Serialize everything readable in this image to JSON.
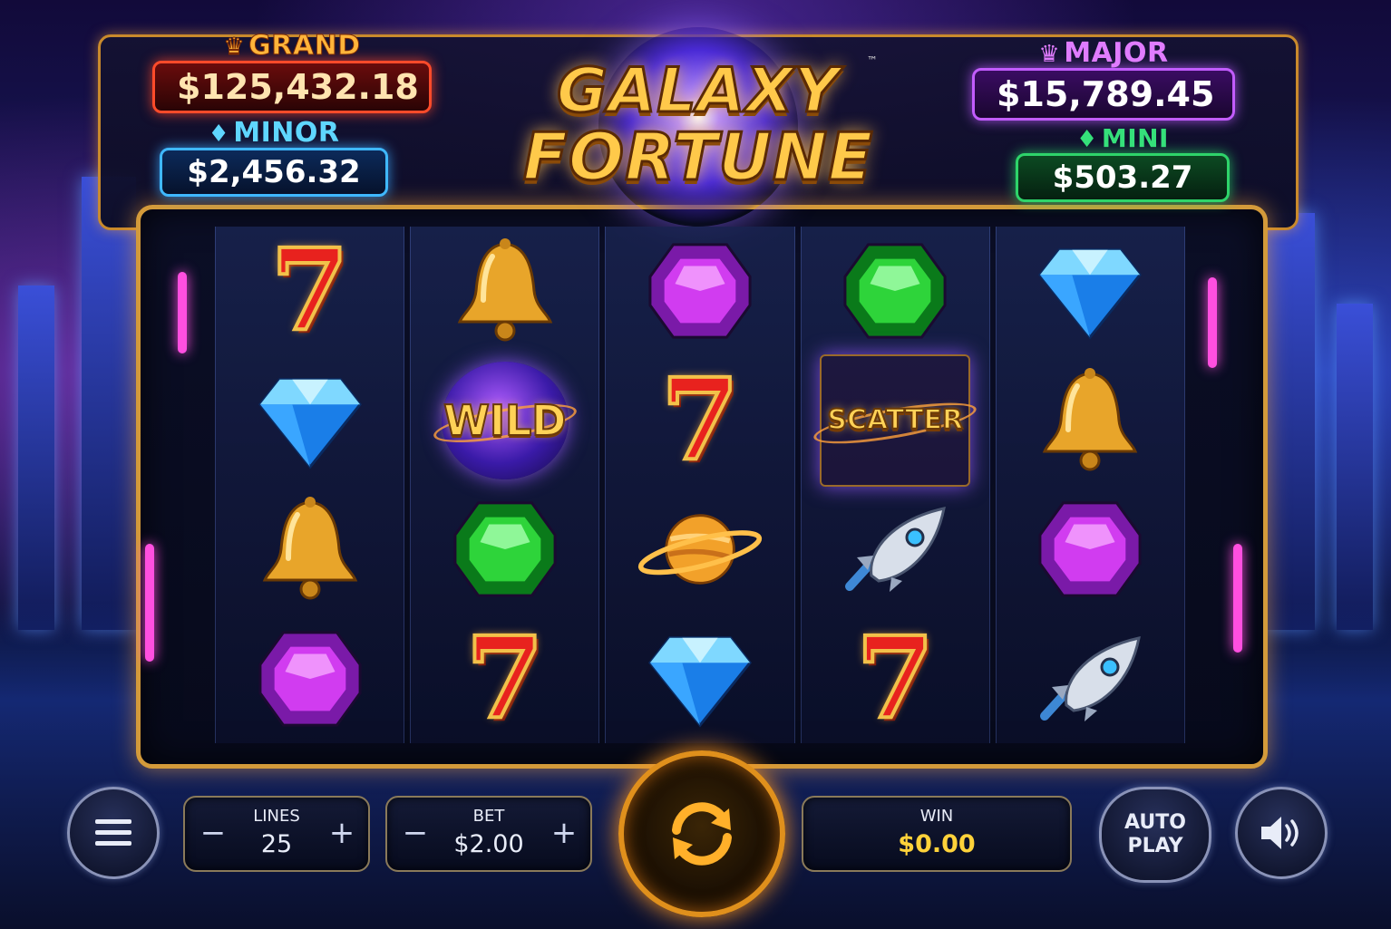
{
  "game": {
    "logo_line1": "GALAXY",
    "logo_line2": "FORTUNE",
    "trademark": "™"
  },
  "jackpots": {
    "grand": {
      "label": "GRAND",
      "amount": "$125,432.18",
      "color": "#ff4b2a"
    },
    "minor": {
      "label": "MINOR",
      "amount": "$2,456.32",
      "color": "#3fb8ff"
    },
    "major": {
      "label": "MAJOR",
      "amount": "$15,789.45",
      "color": "#c25cff"
    },
    "mini": {
      "label": "MINI",
      "amount": "$503.27",
      "color": "#2ed46a"
    }
  },
  "reels": [
    [
      "seven",
      "blue-diamond",
      "bell",
      "purple-gem"
    ],
    [
      "bell",
      "wild",
      "green-gem",
      "seven"
    ],
    [
      "purple-gem",
      "seven",
      "planet",
      "blue-diamond"
    ],
    [
      "green-gem",
      "scatter",
      "rocket",
      "seven"
    ],
    [
      "blue-diamond",
      "bell",
      "purple-gem",
      "rocket"
    ]
  ],
  "symbols": {
    "seven_text": "7",
    "wild_text": "WILD",
    "scatter_text": "SCATTER"
  },
  "controls": {
    "menu_icon": "hamburger-menu-icon",
    "lines": {
      "label": "LINES",
      "value": "25",
      "minus": "−",
      "plus": "+"
    },
    "bet": {
      "label": "BET",
      "value": "$2.00",
      "minus": "−",
      "plus": "+"
    },
    "spin_icon": "refresh-spin-icon",
    "win": {
      "label": "WIN",
      "value": "$0.00",
      "value_color": "#ffd23a"
    },
    "autoplay_line1": "AUTO",
    "autoplay_line2": "PLAY",
    "sound_icon": "speaker-volume-icon"
  },
  "colors": {
    "accent_gold": "#d39a3a",
    "spin_orange": "#e0901c"
  }
}
